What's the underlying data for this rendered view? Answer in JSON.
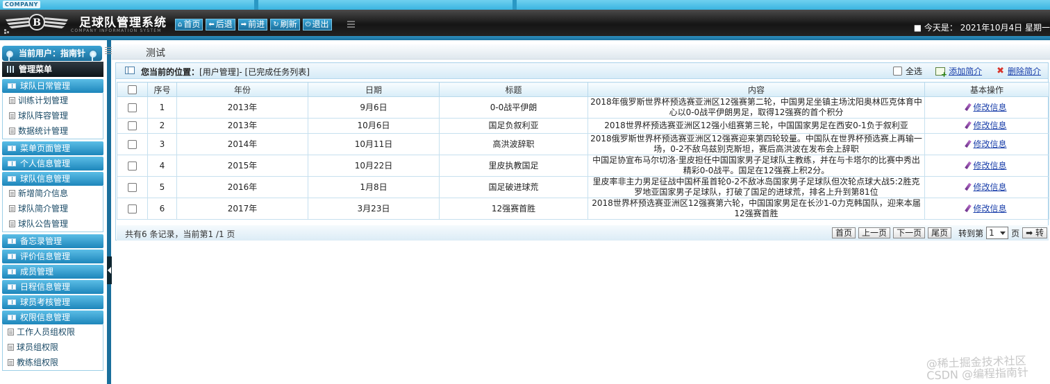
{
  "header": {
    "company": "COMPANY",
    "title": "足球队管理系统",
    "subtitle": "COMPANY INFORMATION SYSTEM",
    "nav": [
      {
        "label": "首页",
        "icon": "home-icon",
        "glyph": "⌂"
      },
      {
        "label": "后退",
        "icon": "arrow-left-icon",
        "glyph": "⬅"
      },
      {
        "label": "前进",
        "icon": "arrow-right-icon",
        "glyph": "➡"
      },
      {
        "label": "刷新",
        "icon": "refresh-icon",
        "glyph": "↻"
      },
      {
        "label": "退出",
        "icon": "power-icon",
        "glyph": "⏻"
      }
    ],
    "today": "■ 今天是： 2021年10月4日 星期一"
  },
  "sidebar": {
    "current_user": "当前用户：指南针",
    "menu_title": "管理菜单",
    "sections": [
      {
        "label": "球队日常管理",
        "items": [
          "训练计划管理",
          "球队阵容管理",
          "数据统计管理"
        ]
      },
      {
        "label": "菜单页面管理",
        "items": []
      },
      {
        "label": "个人信息管理",
        "items": []
      },
      {
        "label": "球队信息管理",
        "items": [
          "新增简介信息",
          "球队简介管理",
          "球队公告管理"
        ]
      },
      {
        "label": "备忘录管理",
        "items": []
      },
      {
        "label": "评价信息管理",
        "items": []
      },
      {
        "label": "成员管理",
        "items": []
      },
      {
        "label": "日程信息管理",
        "items": []
      },
      {
        "label": "球员考核管理",
        "items": []
      },
      {
        "label": "权限信息管理",
        "items": [
          "工作人员组权限",
          "球员组权限",
          "教练组权限"
        ]
      }
    ]
  },
  "main": {
    "tab_title": "测试",
    "location_label": "您当前的位置：",
    "location_path": "[用户管理]- [已完成任务列表]",
    "select_all": "全选",
    "add_link": "添加简介",
    "delete_link": "删除简介",
    "table": {
      "headers": [
        "",
        "序号",
        "年份",
        "日期",
        "标题",
        "内容",
        "基本操作"
      ],
      "edit_label": "修改信息",
      "rows": [
        {
          "no": "1",
          "year": "2013年",
          "date": "9月6日",
          "title": "0-0战平伊朗",
          "content": "2018年俄罗斯世界杯预选赛亚洲区12强赛第二轮，中国男足坐镇主场沈阳奥林匹克体育中心以0-0战平伊朗男足，取得12强赛的首个积分"
        },
        {
          "no": "2",
          "year": "2013年",
          "date": "10月6日",
          "title": "国足负叙利亚",
          "content": "2018世界杯预选赛亚洲区12强小组赛第三轮，中国国家男足在西安0-1负于叙利亚"
        },
        {
          "no": "3",
          "year": "2014年",
          "date": "10月11日",
          "title": "高洪波辞职",
          "content": "2018俄罗斯世界杯预选赛亚洲区12强赛迎来第四轮较量。中国队在世界杯预选赛上再输一场，0-2不敌乌兹别克斯坦，赛后高洪波在发布会上辞职"
        },
        {
          "no": "4",
          "year": "2015年",
          "date": "10月22日",
          "title": "里皮执教国足",
          "content": "中国足协宣布马尔切洛·里皮担任中国国家男子足球队主教练，并在与卡塔尔的比赛中秀出精彩0-0战平。国足在12强赛上积2分。"
        },
        {
          "no": "5",
          "year": "2016年",
          "date": "1月8日",
          "title": "国足破进球荒",
          "content": "里皮率非主力男足征战中国杯虽首轮0-2不敌冰岛国家男子足球队但次轮点球大战5:2胜克罗地亚国家男子足球队，打破了国足的进球荒，排名上升到第81位"
        },
        {
          "no": "6",
          "year": "2017年",
          "date": "3月23日",
          "title": "12强赛首胜",
          "content": "2018世界杯预选赛亚洲区12强赛第六轮，中国国家男足在长沙1-0力克韩国队，迎来本届12强赛首胜"
        }
      ]
    },
    "pager": {
      "info": "共有6 条记录，当前第1 /1 页",
      "first": "首页",
      "prev": "上一页",
      "next": "下一页",
      "last": "尾页",
      "goto_label": "转到第",
      "page_value": "1",
      "page_suffix": "页",
      "go": "➡ 转"
    }
  },
  "watermark": {
    "line1": "@稀土掘金技术社区",
    "line2": "CSDN @编程指南针"
  },
  "colors": {
    "accent": "#1a6f9c",
    "header_dark": "#151515",
    "link": "#1a3faa"
  }
}
